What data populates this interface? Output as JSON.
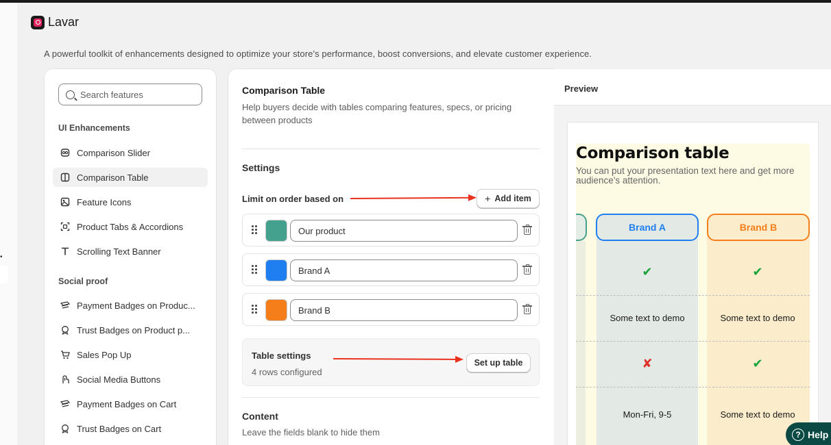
{
  "app": {
    "name": "Lavar",
    "subtitle": "A powerful toolkit of enhancements designed to optimize your store's performance, boost conversions, and elevate customer experience."
  },
  "sidebar": {
    "search_placeholder": "Search features",
    "sections": [
      {
        "title": "UI Enhancements",
        "items": [
          {
            "label": "Comparison Slider",
            "icon": "slider-icon",
            "active": false
          },
          {
            "label": "Comparison Table",
            "icon": "table-icon",
            "active": true
          },
          {
            "label": "Feature Icons",
            "icon": "image-icon",
            "active": false
          },
          {
            "label": "Product Tabs & Accordions",
            "icon": "tabs-icon",
            "active": false
          },
          {
            "label": "Scrolling Text Banner",
            "icon": "text-icon",
            "active": false
          }
        ]
      },
      {
        "title": "Social proof",
        "items": [
          {
            "label": "Payment Badges on Produc...",
            "icon": "payment-icon",
            "active": false
          },
          {
            "label": "Trust Badges on Product p...",
            "icon": "badge-icon",
            "active": false
          },
          {
            "label": "Sales Pop Up",
            "icon": "cart-icon",
            "active": false
          },
          {
            "label": "Social Media Buttons",
            "icon": "hand-icon",
            "active": false
          },
          {
            "label": "Payment Badges on Cart",
            "icon": "payment-icon",
            "active": false
          },
          {
            "label": "Trust Badges on Cart",
            "icon": "badge-icon",
            "active": false
          }
        ]
      }
    ]
  },
  "settings": {
    "title": "Comparison Table",
    "description": "Help buyers decide with tables comparing features, specs, or pricing between products",
    "settings_heading": "Settings",
    "limit_label": "Limit on order based on",
    "add_item_label": "Add item",
    "items": [
      {
        "value": "Our product",
        "color": "#44a18e"
      },
      {
        "value": "Brand A",
        "color": "#1f7ff0"
      },
      {
        "value": "Brand B",
        "color": "#f57e1a"
      }
    ],
    "table_settings_title": "Table settings",
    "table_settings_sub": "4 rows configured",
    "setup_label": "Set up table",
    "content_heading": "Content",
    "content_sub": "Leave the fields blank to hide them"
  },
  "preview": {
    "label": "Preview",
    "title": "Comparison table",
    "text": "You can put your presentation text here and get more audience's attention.",
    "columns": [
      {
        "name": "Brand A",
        "color": "#1f7ff0",
        "fill": "#e3e9e4",
        "cells": [
          "✔",
          "Some text to demo",
          "✘",
          "Mon-Fri, 9-5"
        ]
      },
      {
        "name": "Brand B",
        "color": "#f57e1a",
        "fill": "#fbeccb",
        "cells": [
          "✔",
          "Some text to demo",
          "✔",
          "Some text to demo"
        ]
      }
    ]
  },
  "help_label": "Help"
}
